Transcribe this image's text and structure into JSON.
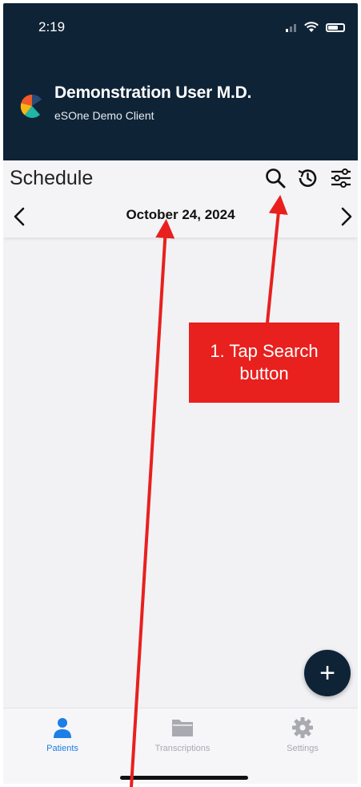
{
  "status_bar": {
    "time": "2:19"
  },
  "header": {
    "user_name": "Demonstration User M.D.",
    "client_name": "eSOne Demo Client"
  },
  "toolbar": {
    "title": "Schedule",
    "search_icon": "search-icon",
    "history_icon": "history-icon",
    "filter_icon": "sliders-icon"
  },
  "date_nav": {
    "date": "October 24, 2024",
    "prev_icon": "chevron-left-icon",
    "next_icon": "chevron-right-icon"
  },
  "fab": {
    "label": "+"
  },
  "bottom_nav": {
    "tabs": [
      {
        "label": "Patients",
        "icon": "person-icon",
        "active": true
      },
      {
        "label": "Transcriptions",
        "icon": "folder-icon",
        "active": false
      },
      {
        "label": "Settings",
        "icon": "gear-icon",
        "active": false
      }
    ]
  },
  "annotation": {
    "callout_text": "1. Tap Search\nbutton"
  },
  "colors": {
    "header_bg": "#0f2337",
    "accent_blue": "#1c7ee6",
    "annotation_red": "#e8201e",
    "inactive_tab": "#a9a9b0"
  }
}
